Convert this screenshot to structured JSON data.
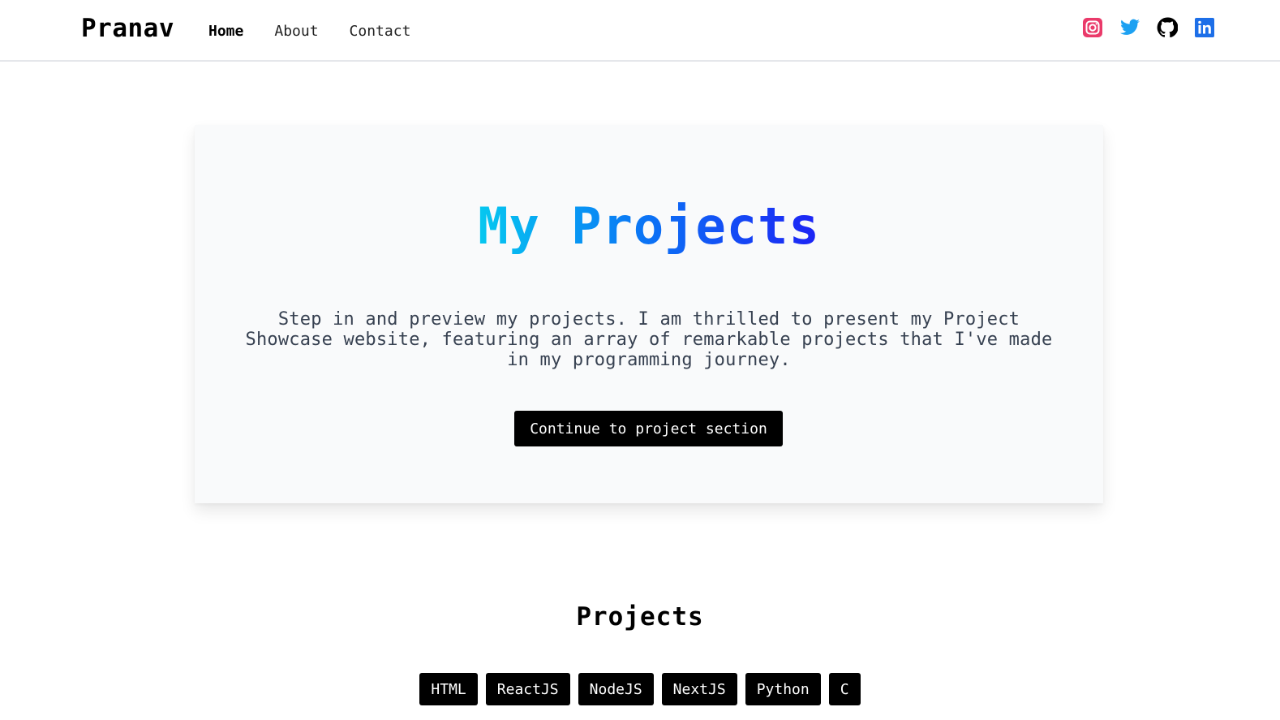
{
  "navbar": {
    "brand": "Pranav",
    "links": [
      {
        "label": "Home",
        "active": true
      },
      {
        "label": "About",
        "active": false
      },
      {
        "label": "Contact",
        "active": false
      }
    ],
    "socials": [
      {
        "icon": "instagram-icon",
        "color": "#e1306c"
      },
      {
        "icon": "twitter-icon",
        "color": "#1da1f2"
      },
      {
        "icon": "github-icon",
        "color": "#000000"
      },
      {
        "icon": "linkedin-icon",
        "color": "#1d6fe8"
      }
    ]
  },
  "hero": {
    "title": "My Projects",
    "description": "Step in and preview my projects. I am thrilled to present my Project Showcase website, featuring an array of remarkable projects that I've made in my programming journey.",
    "button_label": "Continue to project section",
    "title_gradient": [
      "#06c8f0",
      "#0a7af5",
      "#1d23f5"
    ]
  },
  "projects": {
    "heading": "Projects",
    "tags": [
      "HTML",
      "ReactJS",
      "NodeJS",
      "NextJS",
      "Python",
      "C"
    ]
  }
}
